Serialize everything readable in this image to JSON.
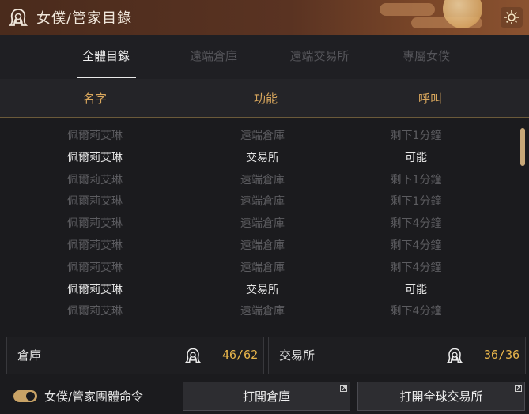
{
  "window": {
    "title": "女僕/管家目錄"
  },
  "tabs": [
    {
      "label": "全體目錄",
      "active": true
    },
    {
      "label": "遠端倉庫",
      "active": false
    },
    {
      "label": "遠端交易所",
      "active": false
    },
    {
      "label": "專屬女僕",
      "active": false
    }
  ],
  "columns": [
    "名字",
    "功能",
    "呼叫"
  ],
  "rows": [
    {
      "name": "佩爾莉艾琳",
      "function": "遠端倉庫",
      "call": "剩下1分鐘",
      "available": false
    },
    {
      "name": "佩爾莉艾琳",
      "function": "交易所",
      "call": "可能",
      "available": true
    },
    {
      "name": "佩爾莉艾琳",
      "function": "遠端倉庫",
      "call": "剩下1分鐘",
      "available": false
    },
    {
      "name": "佩爾莉艾琳",
      "function": "遠端倉庫",
      "call": "剩下1分鐘",
      "available": false
    },
    {
      "name": "佩爾莉艾琳",
      "function": "遠端倉庫",
      "call": "剩下4分鐘",
      "available": false
    },
    {
      "name": "佩爾莉艾琳",
      "function": "遠端倉庫",
      "call": "剩下4分鐘",
      "available": false
    },
    {
      "name": "佩爾莉艾琳",
      "function": "遠端倉庫",
      "call": "剩下4分鐘",
      "available": false
    },
    {
      "name": "佩爾莉艾琳",
      "function": "交易所",
      "call": "可能",
      "available": true
    },
    {
      "name": "佩爾莉艾琳",
      "function": "遠端倉庫",
      "call": "剩下4分鐘",
      "available": false
    }
  ],
  "stats": {
    "warehouse": {
      "label": "倉庫",
      "value": "46/62",
      "icon": "maid-icon"
    },
    "market": {
      "label": "交易所",
      "value": "36/36",
      "icon": "maid-icon"
    }
  },
  "footer": {
    "toggle_label": "女僕/管家團體命令",
    "toggle_on": true,
    "open_warehouse": "打開倉庫",
    "open_market": "打開全球交易所"
  },
  "colors": {
    "accent": "#e8b54b",
    "header_gold": "#d9a75d",
    "title_bar": "#5a3322"
  }
}
